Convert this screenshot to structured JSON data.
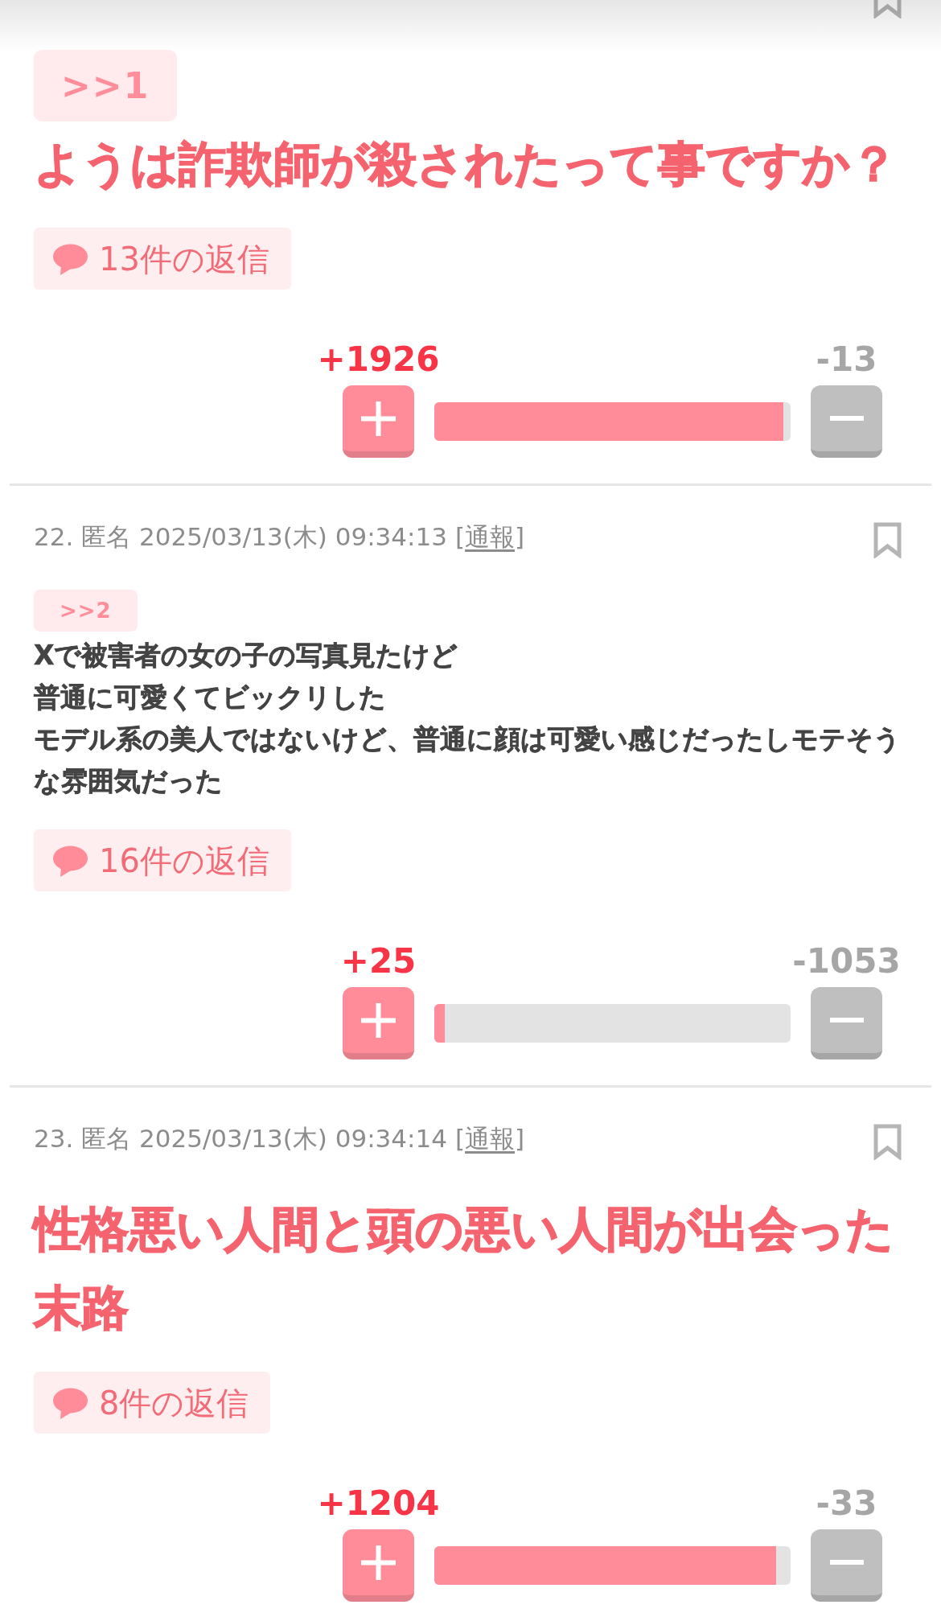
{
  "posts": [
    {
      "kind": "large",
      "anchor": ">>1",
      "lines": [
        "ようは詐欺師が殺されたって事ですか？"
      ],
      "replies": "13件の返信",
      "plus": "+1926",
      "minus": "-13",
      "level": 0.98
    },
    {
      "kind": "normal",
      "meta": "22. 匿名 2025/03/13(木) 09:34:13",
      "report": "[通報]",
      "anchor": ">>2",
      "lines": [
        "Xで被害者の女の子の写真見たけど",
        "普通に可愛くてビックリした",
        "モデル系の美人ではないけど、普通に顔は可愛い感じだったしモテそうな雰囲気だった"
      ],
      "replies": "16件の返信",
      "plus": "+25",
      "minus": "-1053",
      "level": 0.03
    },
    {
      "kind": "large",
      "meta": "23. 匿名 2025/03/13(木) 09:34:14",
      "report": "[通報]",
      "lines": [
        "性格悪い人間と頭の悪い人間が出会った末路"
      ],
      "replies": "8件の返信",
      "plus": "+1204",
      "minus": "-33",
      "level": 0.96
    }
  ]
}
